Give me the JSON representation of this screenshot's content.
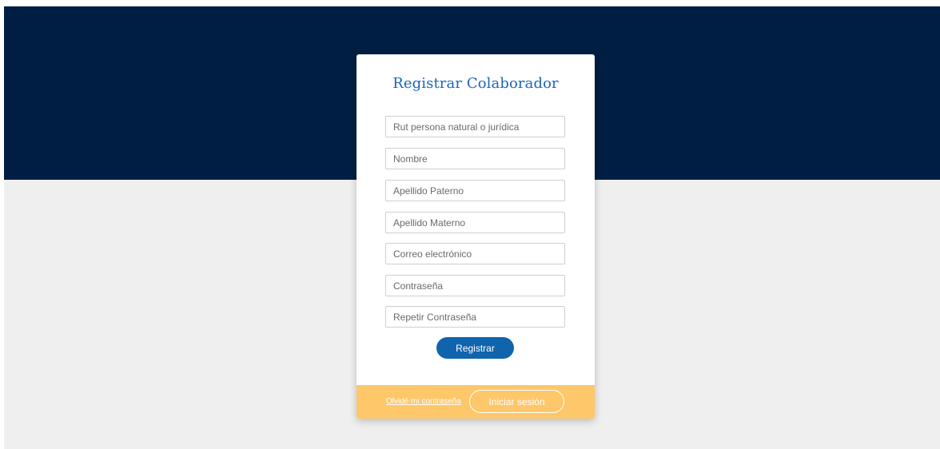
{
  "form": {
    "title": "Registrar Colaborador",
    "fields": [
      {
        "placeholder": "Rut persona natural o jurídica"
      },
      {
        "placeholder": "Nombre"
      },
      {
        "placeholder": "Apellido Paterno"
      },
      {
        "placeholder": "Apellido Materno"
      },
      {
        "placeholder": "Correo electrónico"
      },
      {
        "placeholder": "Contraseña"
      },
      {
        "placeholder": "Repetir Contraseña"
      }
    ],
    "submit_label": "Registrar"
  },
  "footer": {
    "forgot_label": "Olvidé mi contraseña",
    "login_label": "Iniciar sesión"
  },
  "colors": {
    "header_background": "#001e43",
    "page_background": "#efefef",
    "title": "#1b66b8",
    "primary_button": "#0f64ad",
    "footer_background": "#fdc76a"
  }
}
